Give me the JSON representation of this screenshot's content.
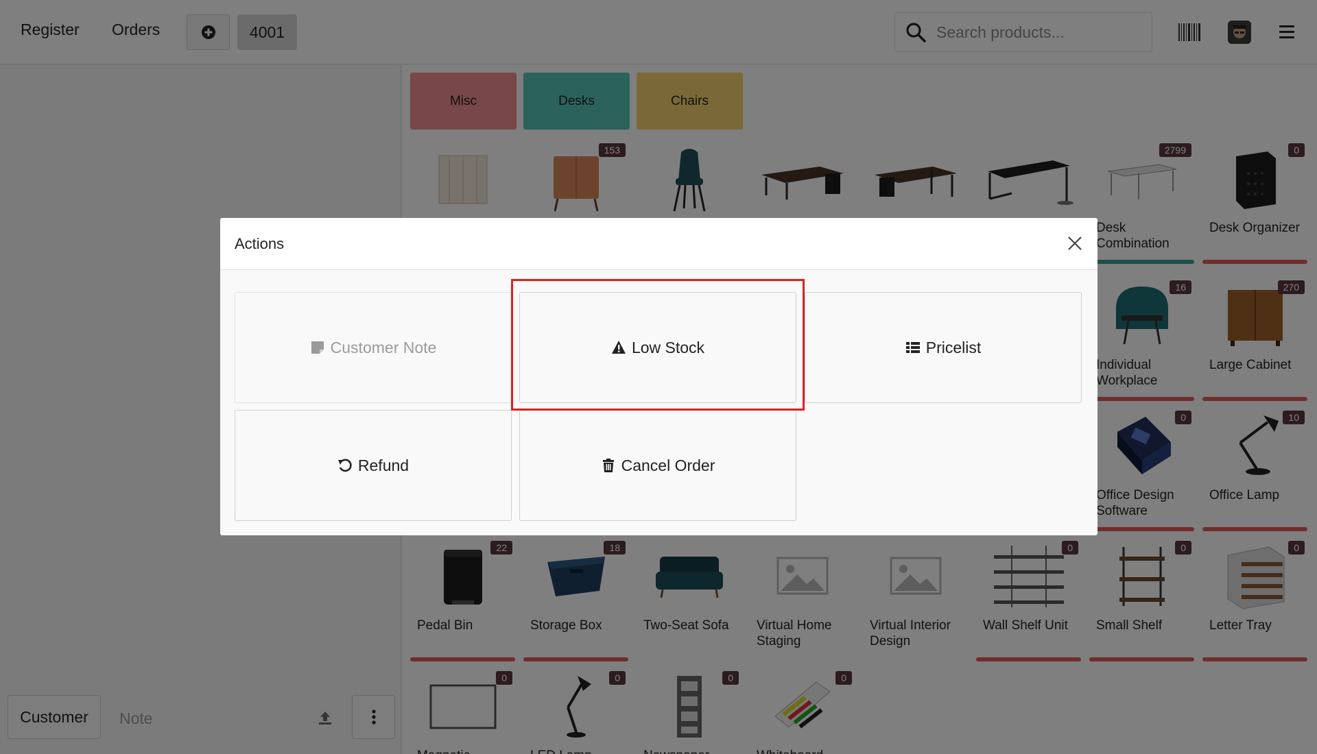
{
  "topbar": {
    "register_label": "Register",
    "orders_label": "Orders",
    "order_tab": "4001",
    "search_placeholder": "Search products..."
  },
  "categories": [
    {
      "label": "Misc",
      "color": "#f18e8f"
    },
    {
      "label": "Desks",
      "color": "#57c4b8"
    },
    {
      "label": "Chairs",
      "color": "#f5d26d"
    }
  ],
  "products": [
    {
      "name": "",
      "badge": ""
    },
    {
      "name": "",
      "badge": "153"
    },
    {
      "name": "",
      "badge": ""
    },
    {
      "name": "",
      "badge": ""
    },
    {
      "name": "",
      "badge": ""
    },
    {
      "name": "",
      "badge": ""
    },
    {
      "name": "Desk Combination",
      "badge": "2799"
    },
    {
      "name": "Desk Organizer",
      "badge": "0"
    },
    {
      "name": "Individual Workplace",
      "badge": "16"
    },
    {
      "name": "Large Cabinet",
      "badge": "270"
    },
    {
      "name": "Office Design Software",
      "badge": "0"
    },
    {
      "name": "Office Lamp",
      "badge": "10"
    },
    {
      "name": "Pedal Bin",
      "badge": "22"
    },
    {
      "name": "Storage Box",
      "badge": "18"
    },
    {
      "name": "Two-Seat Sofa",
      "badge": ""
    },
    {
      "name": "Virtual Home Staging",
      "badge": ""
    },
    {
      "name": "Virtual Interior Design",
      "badge": ""
    },
    {
      "name": "Wall Shelf Unit",
      "badge": "0"
    },
    {
      "name": "Small Shelf",
      "badge": "0"
    },
    {
      "name": "Letter Tray",
      "badge": "0"
    },
    {
      "name": "Magnetic",
      "badge": "0"
    },
    {
      "name": "LED Lamp",
      "badge": "0"
    },
    {
      "name": "Newspaper",
      "badge": "0"
    },
    {
      "name": "Whiteboard",
      "badge": "0"
    }
  ],
  "left_pane": {
    "customer_label": "Customer",
    "note_label": "Note"
  },
  "modal": {
    "title": "Actions",
    "actions": {
      "customer_note": "Customer Note",
      "low_stock": "Low Stock",
      "pricelist": "Pricelist",
      "refund": "Refund",
      "cancel_order": "Cancel Order"
    }
  },
  "colors": {
    "low_stock_bar": "#e35b5b",
    "in_stock_bar": "#3aa198",
    "badge": "#59393f",
    "highlight": "#e01f1f"
  }
}
